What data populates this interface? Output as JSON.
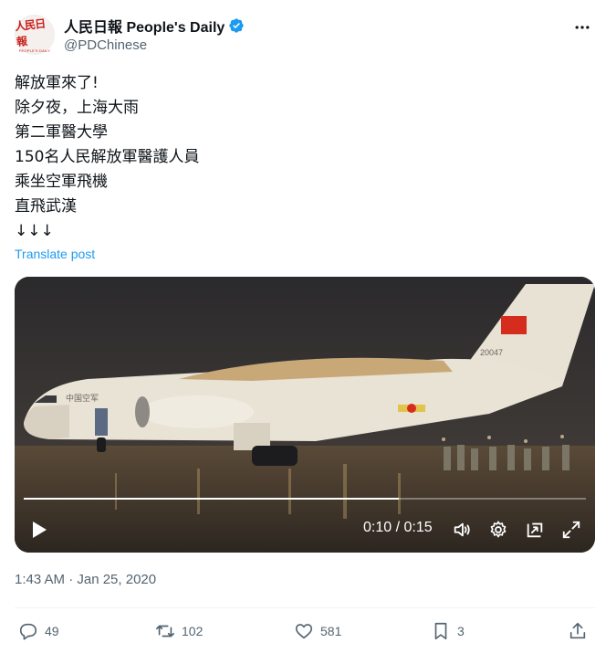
{
  "account": {
    "logo_text": "人民日報",
    "logo_subtext": "PEOPLE'S DAILY",
    "display_name": "人民日報 People's Daily",
    "handle": "@PDChinese",
    "verified": true
  },
  "post": {
    "lines": [
      "解放軍來了!",
      "除夕夜，上海大雨",
      "第二軍醫大學",
      "150名人民解放軍醫護人員",
      "乘坐空軍飛機",
      "直飛武漢",
      "↓↓↓"
    ],
    "translate_label": "Translate post",
    "timestamp": "1:43 AM · Jan 25, 2020"
  },
  "video": {
    "time_display": "0:10 / 0:15",
    "progress": 0.667,
    "tail_number": "20047",
    "fuselage_text": "中国空军"
  },
  "actions": {
    "replies": "49",
    "reposts": "102",
    "likes": "581",
    "bookmarks": "3"
  },
  "colors": {
    "accent": "#1d9bf0",
    "secondary_text": "#536471",
    "primary_text": "#0f1419"
  }
}
